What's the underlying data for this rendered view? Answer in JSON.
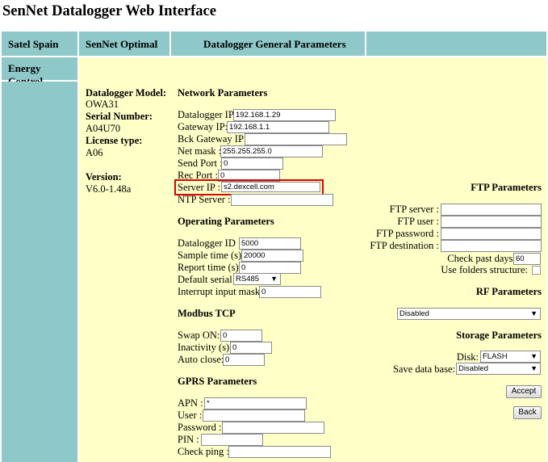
{
  "title": "SenNet Datalogger Web Interface",
  "nav": {
    "tab1": "Satel Spain",
    "tab2": "SenNet Optimal",
    "tab3": "Datalogger General Parameters",
    "side1": "Energy Control"
  },
  "info": {
    "model_label": "Datalogger Model:",
    "model_value": "OWA31",
    "serial_label": "Serial Number:",
    "serial_value": "A04U70",
    "license_label": "License type:",
    "license_value": "A06",
    "version_label": "Version:",
    "version_value": "V6.0-1.48a"
  },
  "network": {
    "heading": "Network Parameters",
    "ip_label": "Datalogger IP:",
    "ip_value": "192.168.1.29",
    "gateway_label": "Gateway IP:",
    "gateway_value": "192.168.1.1",
    "bck_gateway_label": "Bck Gateway IP:",
    "bck_gateway_value": "",
    "netmask_label": "Net mask :",
    "netmask_value": "255.255.255.0",
    "send_port_label": "Send Port :",
    "send_port_value": "0",
    "rec_port_label": "Rec Port :",
    "rec_port_value": "0",
    "server_ip_label": "Server IP :",
    "server_ip_value": "s2.dexcell.com",
    "ntp_label": "NTP Server :",
    "ntp_value": ""
  },
  "operating": {
    "heading": "Operating Parameters",
    "id_label": "Datalogger ID :",
    "id_value": "5000",
    "sample_label": "Sample time (s):",
    "sample_value": "20000",
    "report_label": "Report time (s):",
    "report_value": "0",
    "serial_label": "Default serial :",
    "serial_value": "RS485",
    "interrupt_label": "Interrupt input mask:",
    "interrupt_value": "0"
  },
  "modbus": {
    "heading": "Modbus TCP",
    "swap_label": "Swap ON:",
    "swap_value": "0",
    "inactivity_label": "Inactivity (s):",
    "inactivity_value": "0",
    "autoclose_label": "Auto close:",
    "autoclose_value": "0"
  },
  "gprs": {
    "heading": "GPRS Parameters",
    "apn_label": "APN :",
    "apn_value": "*",
    "user_label": "User :",
    "user_value": "",
    "password_label": "Password :",
    "password_value": "",
    "pin_label": "PIN :",
    "pin_value": "",
    "ping_label": "Check ping :",
    "ping_value": ""
  },
  "ftp": {
    "heading": "FTP Parameters",
    "server_label": "FTP server :",
    "server_value": "",
    "user_label": "FTP user :",
    "user_value": "",
    "password_label": "FTP password :",
    "password_value": "",
    "dest_label": "FTP destination :",
    "dest_value": "",
    "days_label": "Check past days:",
    "days_value": "60",
    "folders_label": "Use folders structure:"
  },
  "rf": {
    "heading": "RF Parameters",
    "value": "Disabled"
  },
  "storage": {
    "heading": "Storage Parameters",
    "disk_label": "Disk:",
    "disk_value": "FLASH",
    "db_label": "Save data base:",
    "db_value": "Disabled"
  },
  "buttons": {
    "accept": "Accept",
    "back": "Back"
  },
  "colors": {
    "teal": "#8ec8c8",
    "panel": "#ffffc8",
    "highlight": "#e00000"
  }
}
